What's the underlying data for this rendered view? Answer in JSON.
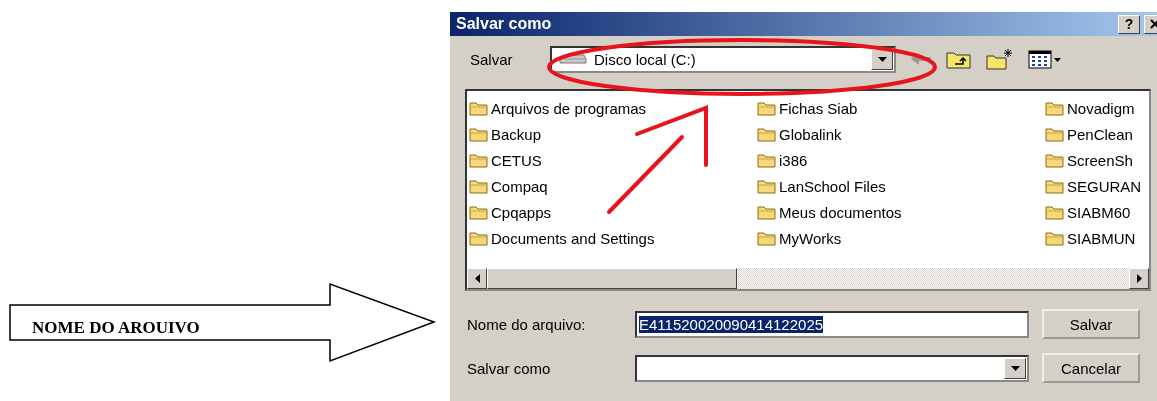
{
  "callout": {
    "label": "NOME DO AROUIVO"
  },
  "dialog": {
    "title": "Salvar como",
    "help_button": "?",
    "save_in": {
      "label": "Salvar",
      "value": "Disco local (C:)"
    },
    "folder_columns": [
      [
        "Arquivos de programas",
        "Backup",
        "CETUS",
        "Compaq",
        "Cpqapps",
        "Documents and Settings"
      ],
      [
        "Fichas Siab",
        "Globalink",
        "i386",
        "LanSchool Files",
        "Meus documentos",
        "MyWorks"
      ],
      [
        "Novadigm",
        "PenClean",
        "ScreenSh",
        "SEGURAN",
        "SIABM60",
        "SIABMUN"
      ]
    ],
    "file_name": {
      "label": "Nome do arquivo:",
      "value": "E411520020090414122025",
      "selected": true
    },
    "save_as_type": {
      "label": "Salvar como"
    },
    "buttons": [
      "Salvar",
      "Cancelar"
    ]
  }
}
